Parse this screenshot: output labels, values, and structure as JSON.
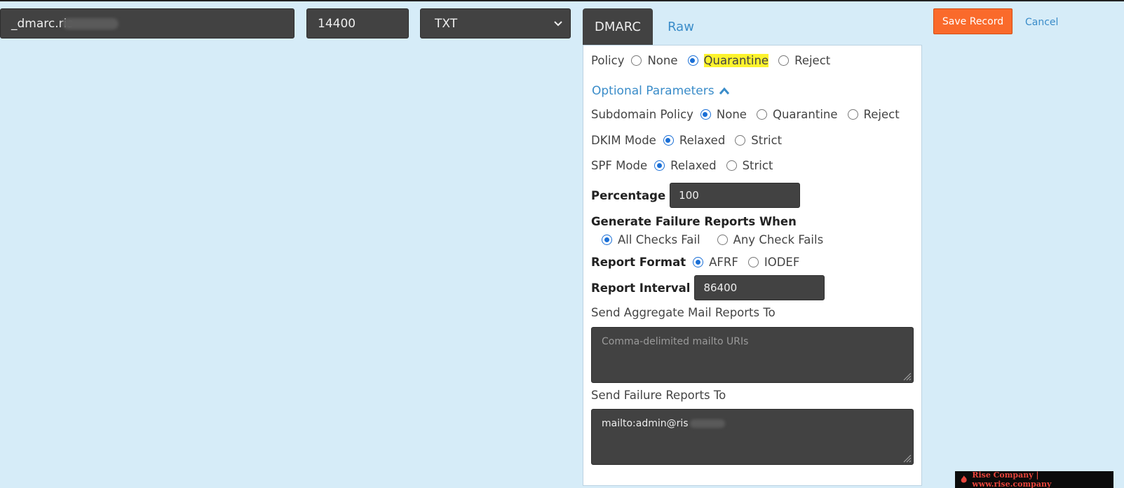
{
  "record": {
    "name_value": "_dmarc.ris",
    "ttl_value": "14400",
    "type_value": "TXT"
  },
  "tabs": [
    {
      "label": "DMARC",
      "active": true
    },
    {
      "label": "Raw",
      "active": false
    }
  ],
  "actions": {
    "save_label": "Save Record",
    "cancel_label": "Cancel"
  },
  "dmarc": {
    "policy": {
      "label": "Policy",
      "options": [
        "None",
        "Quarantine",
        "Reject"
      ],
      "selected": "Quarantine"
    },
    "optional_parameters_label": "Optional Parameters",
    "subdomain_policy": {
      "label": "Subdomain Policy",
      "options": [
        "None",
        "Quarantine",
        "Reject"
      ],
      "selected": "None"
    },
    "dkim_mode": {
      "label": "DKIM Mode",
      "options": [
        "Relaxed",
        "Strict"
      ],
      "selected": "Relaxed"
    },
    "spf_mode": {
      "label": "SPF Mode",
      "options": [
        "Relaxed",
        "Strict"
      ],
      "selected": "Relaxed"
    },
    "percentage": {
      "label": "Percentage",
      "value": "100"
    },
    "failure_reports": {
      "label": "Generate Failure Reports When",
      "options": [
        "All Checks Fail",
        "Any Check Fails"
      ],
      "selected": "All Checks Fail"
    },
    "report_format": {
      "label": "Report Format",
      "options": [
        "AFRF",
        "IODEF"
      ],
      "selected": "AFRF"
    },
    "report_interval": {
      "label": "Report Interval",
      "value": "86400"
    },
    "aggregate_reports": {
      "label": "Send Aggregate Mail Reports To",
      "placeholder": "Comma-delimited mailto URIs",
      "value": ""
    },
    "failure_reports_to": {
      "label": "Send Failure Reports To",
      "value": "mailto:admin@ris"
    }
  },
  "watermark": "Rise Company | www.rise.company",
  "colors": {
    "accent": "#fa6a2b",
    "link": "#3a8cc9",
    "radio": "#1a6fd6",
    "field": "#424242",
    "background": "#d6ecf8",
    "highlight": "#fdf32d"
  }
}
